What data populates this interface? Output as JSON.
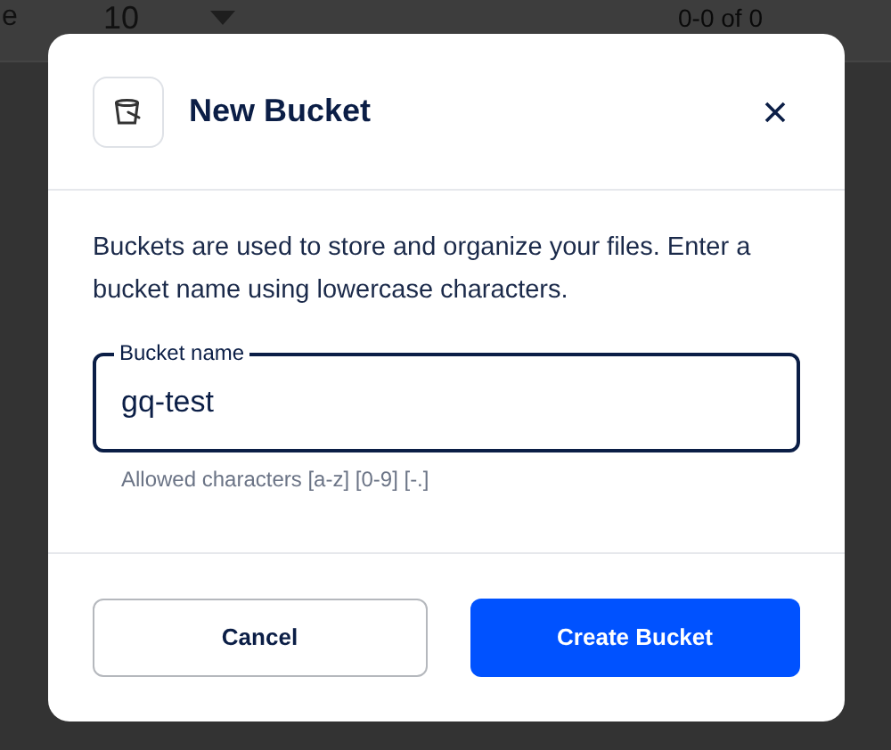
{
  "background": {
    "label": "e",
    "page_size": "10",
    "range": "0-0 of 0"
  },
  "dialog": {
    "title": "New Bucket",
    "description": "Buckets are used to store and organize your files. Enter a bucket name using lowercase characters.",
    "field": {
      "label": "Bucket name",
      "value": "gq-test",
      "helper": "Allowed characters [a-z] [0-9] [-.]"
    },
    "buttons": [
      {
        "label": "Cancel",
        "kind": "secondary"
      },
      {
        "label": "Create Bucket",
        "kind": "primary"
      }
    ]
  }
}
